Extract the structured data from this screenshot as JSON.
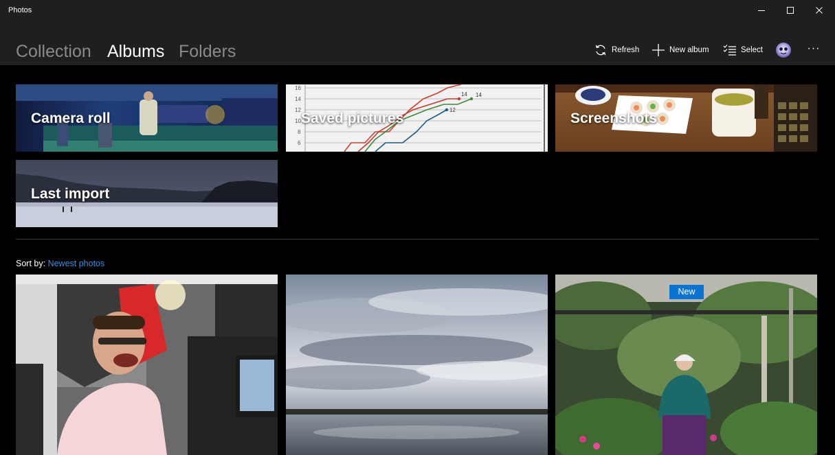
{
  "window": {
    "title": "Photos",
    "minimize_icon": "minimize-icon",
    "maximize_icon": "maximize-icon",
    "close_icon": "close-icon"
  },
  "nav": {
    "tabs": [
      {
        "label": "Collection",
        "active": false
      },
      {
        "label": "Albums",
        "active": true
      },
      {
        "label": "Folders",
        "active": false
      }
    ]
  },
  "toolbar": {
    "refresh_label": "Refresh",
    "new_album_label": "New album",
    "select_label": "Select",
    "more_label": "···"
  },
  "albums": [
    {
      "label": "Camera roll"
    },
    {
      "label": "Saved pictures"
    },
    {
      "label": "Screenshots"
    },
    {
      "label": "Last import"
    }
  ],
  "saved_pictures_chart": {
    "y_ticks": [
      "16",
      "14",
      "12",
      "10",
      "8",
      "6"
    ],
    "point_labels": [
      "14",
      "14",
      "12"
    ]
  },
  "sort": {
    "label": "Sort by:",
    "value": "Newest photos"
  },
  "photos": [
    {
      "badge": ""
    },
    {
      "badge": ""
    },
    {
      "badge": "New"
    }
  ],
  "colors": {
    "accent": "#0a74d2",
    "link": "#3b8fe0",
    "chrome": "#1f1f1f",
    "background": "#000000"
  }
}
